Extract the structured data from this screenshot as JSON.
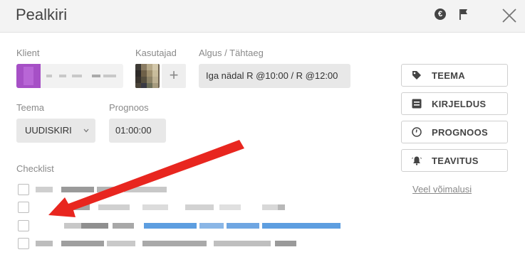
{
  "header": {
    "title": "Pealkiri",
    "euro_symbol": "€"
  },
  "fields": {
    "client_label": "Klient",
    "users_label": "Kasutajad",
    "start_due_label": "Algus / Tähtaeg",
    "start_due_value": "Iga nädal R @10:00 / R @12:00",
    "add_user_symbol": "+",
    "theme_label": "Teema",
    "theme_value": "UUDISKIRI",
    "forecast_label": "Prognoos",
    "forecast_value": "01:00:00",
    "checklist_label": "Checklist"
  },
  "sidebar": {
    "buttons": [
      {
        "label": "TEEMA",
        "icon": "tag-icon"
      },
      {
        "label": "KIRJELDUS",
        "icon": "description-icon"
      },
      {
        "label": "PROGNOOS",
        "icon": "clock-icon"
      },
      {
        "label": "TEAVITUS",
        "icon": "bell-icon"
      }
    ],
    "more_link": "Veel võimalusi"
  },
  "colors": {
    "client_avatar": "#a650c6",
    "annotation_arrow": "#e8261f",
    "link_blur": "#5d9ee0"
  }
}
